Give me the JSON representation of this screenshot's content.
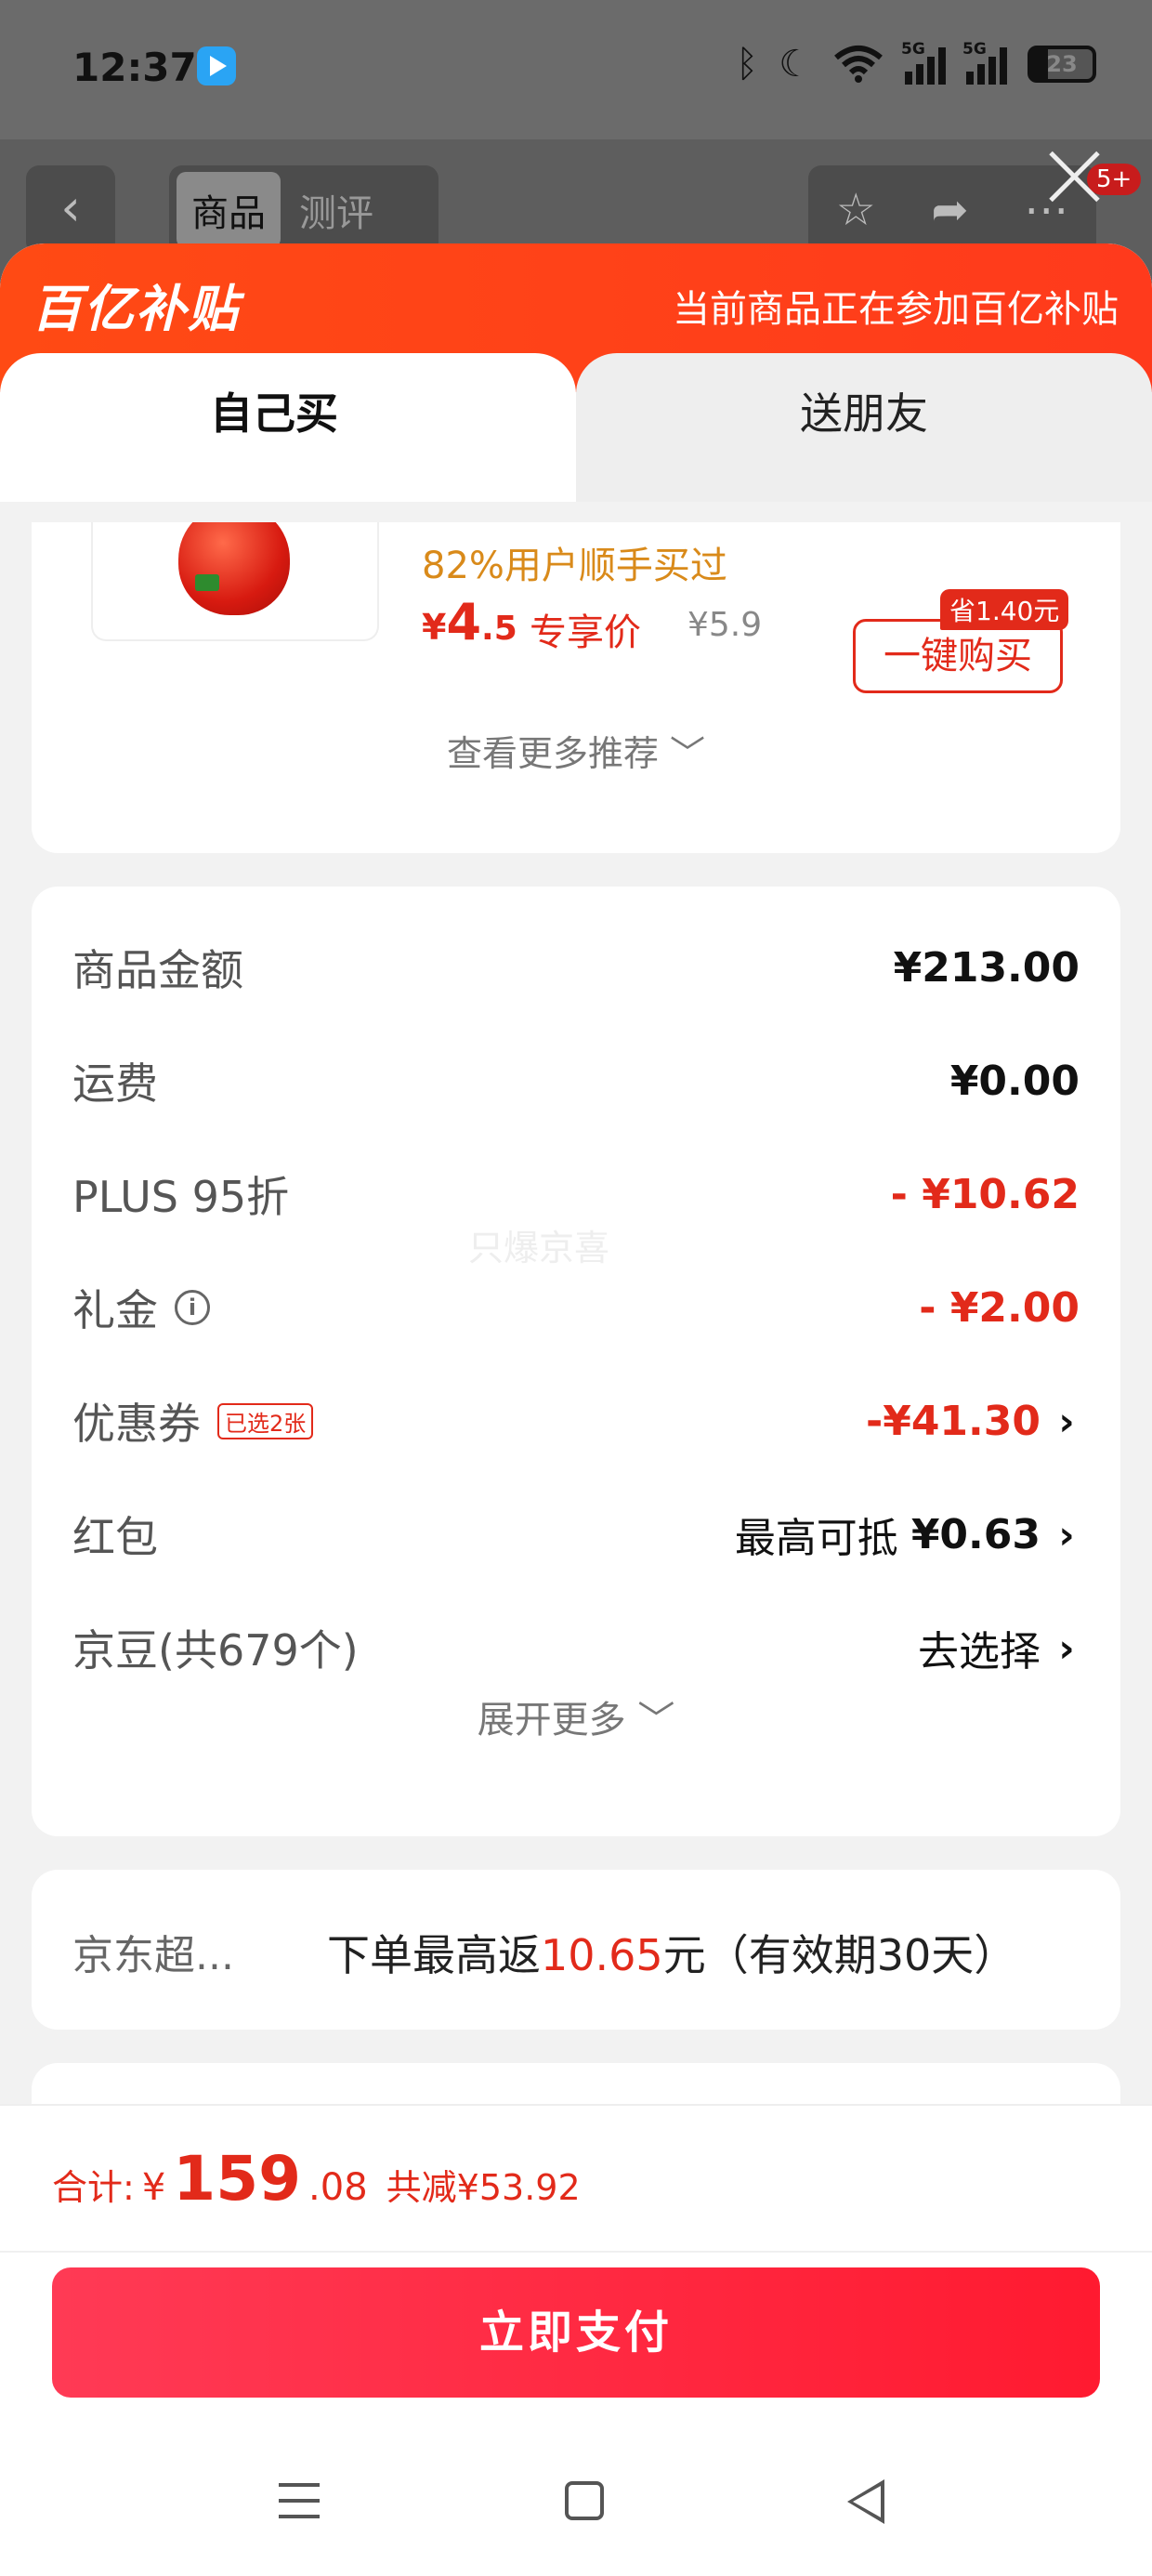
{
  "status_bar": {
    "time": "12:37",
    "battery": "23",
    "net1": "5G",
    "net2": "5G"
  },
  "nav": {
    "back": "‹",
    "tab_product": "商品",
    "tab_review": "测评",
    "badge": "5+"
  },
  "sheet": {
    "brand": "百亿补贴",
    "brand_note": "当前商品正在参加百亿补贴",
    "tabs": {
      "self": "自己买",
      "gift": "送朋友"
    }
  },
  "recommend": {
    "pct_text": "82%用户顺手买过",
    "price_symbol": "¥",
    "price_int": "4",
    "price_dec": ".5",
    "price_label": "专享价",
    "old_price": "¥5.9",
    "save_tag": "省1.40元",
    "buy_label": "一键购买",
    "more_label": "查看更多推荐 ﹀"
  },
  "cost": {
    "rows": [
      {
        "label": "商品金额",
        "value": "¥213.00"
      },
      {
        "label": "运费",
        "value": "¥0.00"
      },
      {
        "label": "PLUS 95折",
        "value": "- ¥10.62"
      },
      {
        "label": "礼金",
        "value": "- ¥2.00"
      },
      {
        "label": "优惠券",
        "tag": "已选2张",
        "value": "-¥41.30"
      },
      {
        "label": "红包",
        "value_prefix": "最高可抵",
        "value": "¥0.63"
      },
      {
        "label": "京豆(共679个)",
        "value": "去选择"
      }
    ],
    "watermark": "只爆京喜",
    "expand_label": "展开更多 ﹀"
  },
  "rebate": {
    "label": "京东超...",
    "text_before": "下单最高返",
    "amount": "10.65",
    "text_after": "元（有效期30天）"
  },
  "bottom": {
    "total_label": "合计:",
    "symbol": "¥",
    "total_int": "159",
    "total_dec": ".08",
    "saved": "共减¥53.92",
    "pay_label": "立即支付"
  },
  "colors": {
    "accent": "#e22a1a",
    "brand_orange": "#ff4a14",
    "pay_button": "#ff2a40"
  }
}
